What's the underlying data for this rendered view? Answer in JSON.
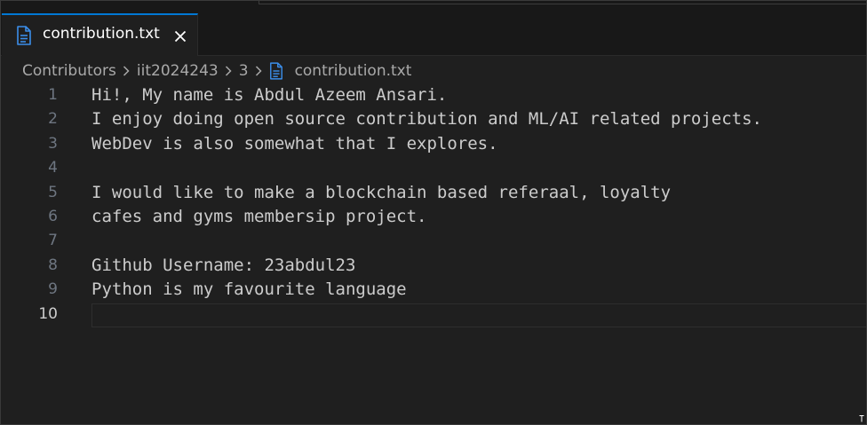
{
  "tab": {
    "label": "contribution.txt",
    "icon": "file-text-icon",
    "close_icon": "close-icon",
    "accent_color": "#0078d4"
  },
  "breadcrumb": {
    "items": [
      "Contributors",
      "iit2024243",
      "3"
    ],
    "file": "contribution.txt"
  },
  "editor": {
    "lines": [
      {
        "number": "1",
        "text": "Hi!, My name is Abdul Azeem Ansari."
      },
      {
        "number": "2",
        "text": "I enjoy doing open source contribution and ML/AI related projects."
      },
      {
        "number": "3",
        "text": "WebDev is also somewhat that I explores."
      },
      {
        "number": "4",
        "text": ""
      },
      {
        "number": "5",
        "text": "I would like to make a blockchain based referaal, loyalty"
      },
      {
        "number": "6",
        "text": "cafes and gyms membersip project."
      },
      {
        "number": "7",
        "text": ""
      },
      {
        "number": "8",
        "text": "Github Username: 23abdul23"
      },
      {
        "number": "9",
        "text": "Python is my favourite language"
      },
      {
        "number": "10",
        "text": ""
      }
    ]
  }
}
